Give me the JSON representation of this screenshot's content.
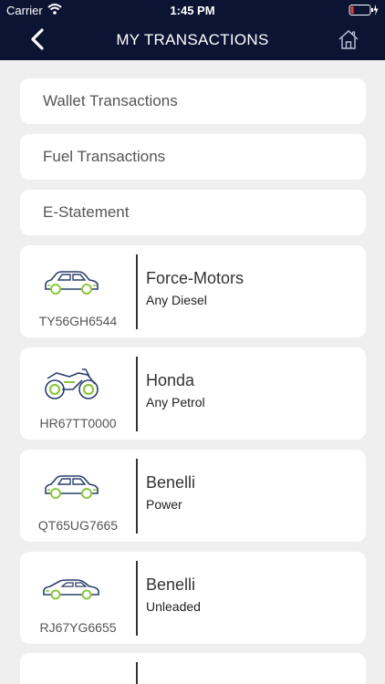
{
  "status": {
    "carrier": "Carrier",
    "time": "1:45 PM"
  },
  "header": {
    "title": "MY TRANSACTIONS",
    "back_icon": "chevron-left-icon",
    "home_icon": "home-icon"
  },
  "menu": [
    {
      "label": "Wallet Transactions"
    },
    {
      "label": "Fuel Transactions"
    },
    {
      "label": "E-Statement"
    }
  ],
  "vehicles": [
    {
      "icon": "car-icon",
      "plate": "TY56GH6544",
      "name": "Force-Motors",
      "fuel": "Any Diesel"
    },
    {
      "icon": "motorcycle-icon",
      "plate": "HR67TT0000",
      "name": "Honda",
      "fuel": "Any Petrol"
    },
    {
      "icon": "car-icon",
      "plate": "QT65UG7665",
      "name": "Benelli",
      "fuel": "Power"
    },
    {
      "icon": "sedan-icon",
      "plate": "RJ67YG6655",
      "name": "Benelli",
      "fuel": "Unleaded"
    }
  ],
  "colors": {
    "header_bg": "#0b1533",
    "icon_blue": "#2b3e6b",
    "icon_green": "#8cc63f",
    "background": "#efefef"
  }
}
